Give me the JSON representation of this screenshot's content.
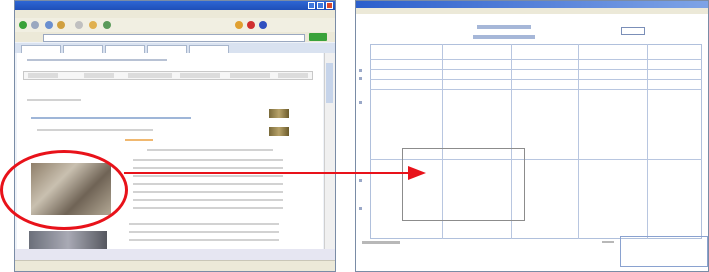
{
  "left_window": {
    "title": "",
    "menu_items": [],
    "highlight_color": "#e8121a",
    "photo_subject": "group-of-people-photo"
  },
  "right_window": {
    "title": "",
    "form_heading": [],
    "empty_box_purpose": "photo-placement-box"
  },
  "connector": {
    "color": "#e8121a",
    "direction": "left-to-right"
  },
  "colors": {
    "window_border": "#7a8ca6",
    "titlebar": "#2e66d4",
    "grid_lines": "#b8c6e0",
    "accent_red": "#e8121a"
  }
}
